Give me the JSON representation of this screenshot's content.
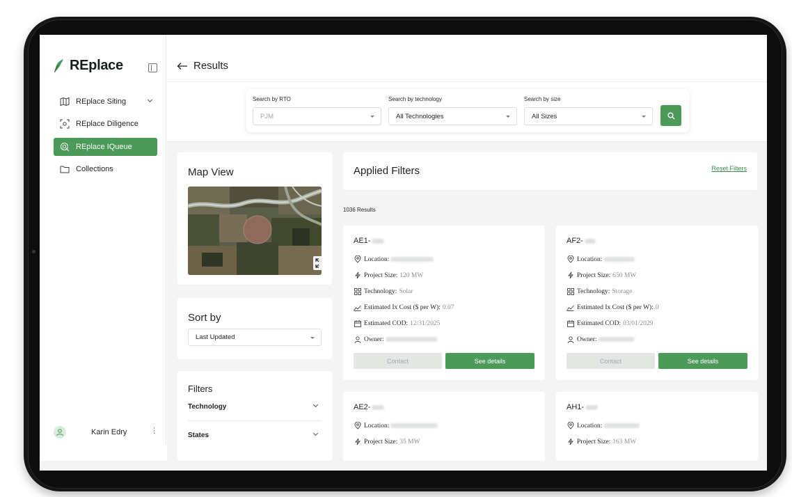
{
  "brand": {
    "name": "REplace",
    "accent": "#4c9a5a"
  },
  "sidebar": {
    "items": [
      {
        "label": "REplace Siting",
        "icon": "map-icon"
      },
      {
        "label": "REplace Diligence",
        "icon": "scan-icon"
      },
      {
        "label": "REplace IQueue",
        "icon": "radar-icon"
      },
      {
        "label": "Collections",
        "icon": "folder-icon"
      }
    ],
    "user": {
      "name": "Karin Edry"
    }
  },
  "header": {
    "back_label": "Results"
  },
  "search": {
    "rto": {
      "label": "Search by RTO",
      "value": "PJM"
    },
    "technology": {
      "label": "Search by technology",
      "value": "All Technologies"
    },
    "size": {
      "label": "Search by size",
      "value": "All Sizes"
    }
  },
  "map": {
    "title": "Map View"
  },
  "sort": {
    "title": "Sort by",
    "value": "Last Updated"
  },
  "filters": {
    "title": "Filters",
    "groups": [
      {
        "label": "Technology"
      },
      {
        "label": "States"
      }
    ]
  },
  "applied": {
    "title": "Applied Filters",
    "reset": "Reset Filters"
  },
  "results_count": "1036 Results",
  "results": [
    {
      "id": "AE1-",
      "location_label": "Location:",
      "size_label": "Project Size:",
      "size": "120 MW",
      "tech_label": "Technology:",
      "tech": "Solar",
      "cost_label": "Estimated Ix Cost ($ per W):",
      "cost": "0.07",
      "cod_label": "Estimated COD:",
      "cod": "12/31/2025",
      "owner_label": "Owner:",
      "contact": "Contact",
      "details": "See details"
    },
    {
      "id": "AF2-",
      "location_label": "Location:",
      "size_label": "Project Size:",
      "size": "650 MW",
      "tech_label": "Technology:",
      "tech": "Storage",
      "cost_label": "Estimated Ix Cost ($ per W):",
      "cost": "0",
      "cod_label": "Estimated COD:",
      "cod": "03/01/2029",
      "owner_label": "Owner:",
      "contact": "Contact",
      "details": "See details"
    },
    {
      "id": "AE2-",
      "location_label": "Location:",
      "size_label": "Project Size:",
      "size": "35 MW"
    },
    {
      "id": "AH1-",
      "location_label": "Location:",
      "size_label": "Project Size:",
      "size": "163 MW"
    }
  ]
}
